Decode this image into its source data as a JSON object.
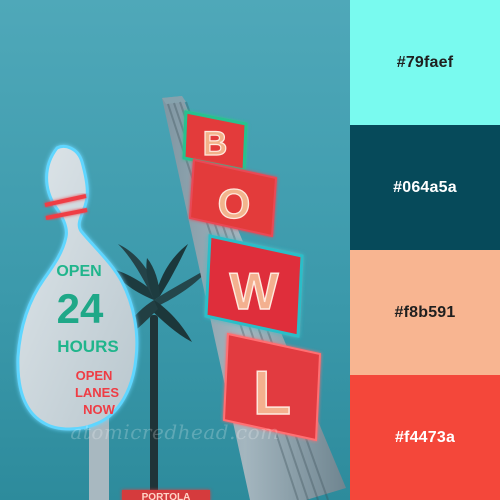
{
  "watermark": {
    "text": "atomicredhead.com"
  },
  "palette": {
    "swatches": [
      {
        "hex": "#79faef",
        "label": "#79faef",
        "text_color": "#1f1f1f"
      },
      {
        "hex": "#064a5a",
        "label": "#064a5a",
        "text_color": "#ffffff"
      },
      {
        "hex": "#f8b591",
        "label": "#f8b591",
        "text_color": "#1f1f1f"
      },
      {
        "hex": "#f4473a",
        "label": "#f4473a",
        "text_color": "#ffffff"
      }
    ]
  },
  "sign": {
    "line1": "OPEN",
    "line2": "24",
    "line3": "HOURS",
    "line4": "OPEN",
    "line5": "LANES",
    "line6": "NOW",
    "tower_letters": [
      "B",
      "O",
      "W",
      "L"
    ],
    "bottom_sign": "PORTOLA"
  }
}
